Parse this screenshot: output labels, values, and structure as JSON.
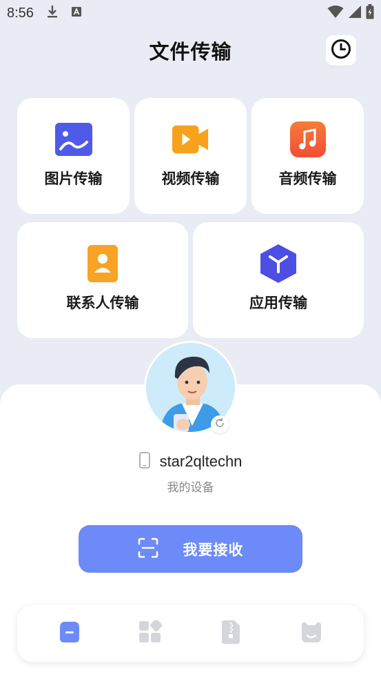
{
  "status_bar": {
    "time": "8:56",
    "icons": [
      "download-icon",
      "a-badge-icon",
      "wifi-icon",
      "signal-icon",
      "battery-icon"
    ]
  },
  "header": {
    "title": "文件传输",
    "history_icon": "clock-icon"
  },
  "categories": [
    {
      "label": "图片传输",
      "icon": "image-icon",
      "color": "#4f5ae8"
    },
    {
      "label": "视频传输",
      "icon": "video-icon",
      "color": "#f7a21b"
    },
    {
      "label": "音频传输",
      "icon": "music-icon",
      "color": "#f5603a"
    },
    {
      "label": "联系人传输",
      "icon": "contact-icon",
      "color": "#f8a325"
    },
    {
      "label": "应用传输",
      "icon": "app-cube-icon",
      "color": "#4c4fe2"
    }
  ],
  "device": {
    "name": "star2qltechn",
    "subtitle": "我的设备",
    "phone_icon": "phone-icon",
    "refresh_icon": "refresh-icon"
  },
  "receive_button": {
    "label": "我要接收",
    "icon": "scan-icon",
    "color": "#6c8af8"
  },
  "tab_bar": {
    "tabs": [
      {
        "icon": "transfer-tab-icon",
        "active": true
      },
      {
        "icon": "apps-tab-icon",
        "active": false
      },
      {
        "icon": "zip-file-tab-icon",
        "active": false
      },
      {
        "icon": "profile-tab-icon",
        "active": false
      }
    ],
    "active_color": "#6c8af8",
    "inactive_color": "#d4d6dc"
  }
}
